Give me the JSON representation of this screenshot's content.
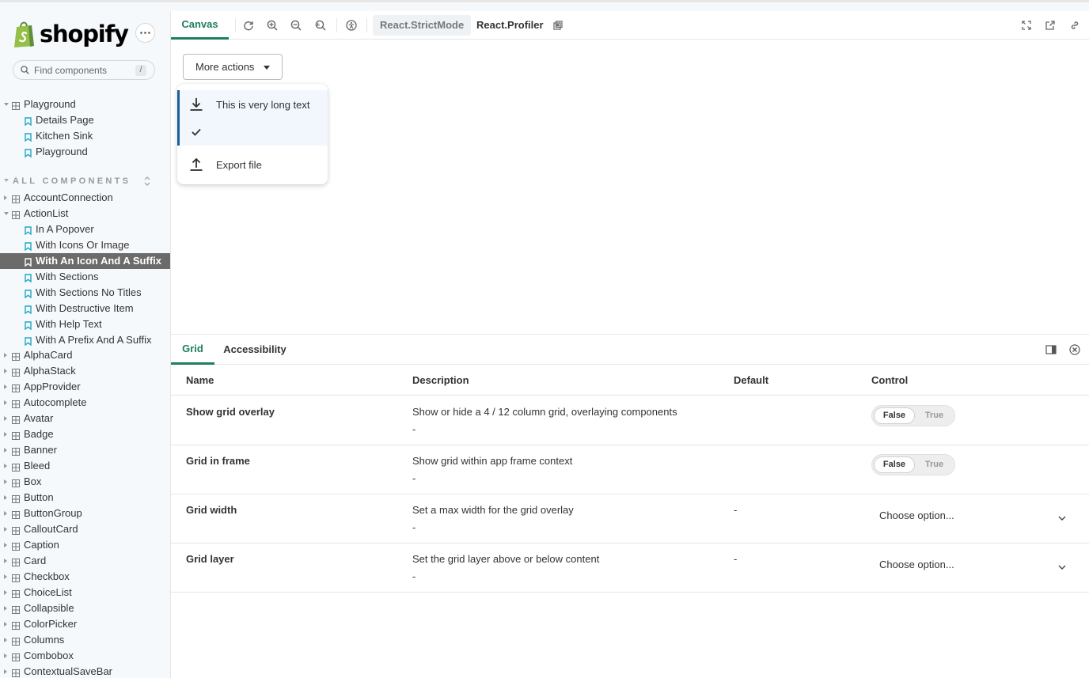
{
  "brand": {
    "name": "shopify",
    "colors": {
      "bag": "#95bf47",
      "bag_dark": "#5e8e3e"
    }
  },
  "sidebar": {
    "search": {
      "placeholder": "Find components",
      "shortcut": "/"
    },
    "playground": {
      "label": "Playground",
      "stories": [
        "Details Page",
        "Kitchen Sink",
        "Playground"
      ]
    },
    "section_title": "ALL COMPONENTS",
    "components_before": [
      "AccountConnection"
    ],
    "expanded_component": {
      "label": "ActionList",
      "stories": [
        "In A Popover",
        "With Icons Or Image",
        "With An Icon And A Suffix",
        "With Sections",
        "With Sections No Titles",
        "With Destructive Item",
        "With Help Text",
        "With A Prefix And A Suffix"
      ],
      "selected_story": "With An Icon And A Suffix"
    },
    "components_after": [
      "AlphaCard",
      "AlphaStack",
      "AppProvider",
      "Autocomplete",
      "Avatar",
      "Badge",
      "Banner",
      "Bleed",
      "Box",
      "Button",
      "ButtonGroup",
      "CalloutCard",
      "Caption",
      "Card",
      "Checkbox",
      "ChoiceList",
      "Collapsible",
      "ColorPicker",
      "Columns",
      "Combobox",
      "ContextualSaveBar"
    ]
  },
  "toolbar": {
    "canvas_tab": "Canvas",
    "strict_mode": "React.StrictMode",
    "profiler": "React.Profiler",
    "accent": "#1e7e5f"
  },
  "preview": {
    "more_actions": "More actions",
    "popover_items": [
      {
        "icon": "import-icon",
        "label": "This is very long text",
        "highlighted": true
      },
      {
        "icon": "checkmark-icon",
        "label": "",
        "highlighted": true
      },
      {
        "icon": "export-icon",
        "label": "Export file",
        "highlighted": false
      }
    ]
  },
  "panel": {
    "tabs": [
      "Grid",
      "Accessibility"
    ],
    "columns": {
      "name": "Name",
      "description": "Description",
      "default": "Default",
      "control": "Control"
    },
    "rows": [
      {
        "name": "Show grid overlay",
        "description": "Show or hide a 4 / 12 column grid, overlaying components",
        "sub": "-",
        "default": "",
        "control": "toggle",
        "false_label": "False",
        "true_label": "True"
      },
      {
        "name": "Grid in frame",
        "description": "Show grid within app frame context",
        "sub": "-",
        "default": "",
        "control": "toggle",
        "false_label": "False",
        "true_label": "True"
      },
      {
        "name": "Grid width",
        "description": "Set a max width for the grid overlay",
        "sub": "-",
        "default": "-",
        "control": "select",
        "select_value": "Choose option..."
      },
      {
        "name": "Grid layer",
        "description": "Set the grid layer above or below content",
        "sub": "-",
        "default": "-",
        "control": "select",
        "select_value": "Choose option..."
      }
    ]
  }
}
